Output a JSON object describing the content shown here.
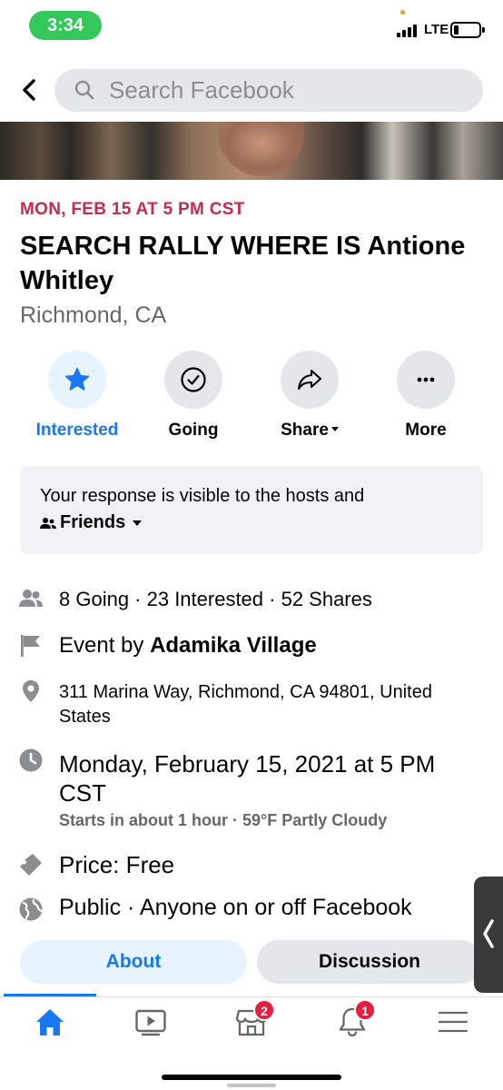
{
  "status_bar": {
    "time": "3:34",
    "network": "LTE"
  },
  "search": {
    "placeholder": "Search Facebook"
  },
  "event": {
    "date_line": "MON, FEB 15 AT 5 PM CST",
    "title": "SEARCH RALLY WHERE IS Antione Whitley",
    "location": "Richmond, CA"
  },
  "actions": [
    {
      "label": "Interested",
      "icon": "star-icon",
      "active": true
    },
    {
      "label": "Going",
      "icon": "check-circle-icon",
      "active": false
    },
    {
      "label": "Share",
      "icon": "share-arrow-icon",
      "active": false
    },
    {
      "label": "More",
      "icon": "more-dots-icon",
      "active": false
    }
  ],
  "response": {
    "text": "Your response is visible to the hosts and",
    "audience": "Friends"
  },
  "details": {
    "attendance": "8 Going · 23 Interested · 52 Shares",
    "host_prefix": "Event by ",
    "host_name": "Adamika Village",
    "address": "311 Marina Way, Richmond, CA 94801, United States",
    "datetime": "Monday, February 15, 2021 at 5 PM CST",
    "datetime_sub": "Starts in about 1 hour · 59°F Partly Cloudy",
    "price": "Price: Free",
    "privacy": "Public · Anyone on or off Facebook"
  },
  "tabs": [
    {
      "label": "About",
      "active": true
    },
    {
      "label": "Discussion",
      "active": false
    }
  ],
  "bottom_nav": [
    {
      "icon": "home-icon",
      "active": true,
      "badge": ""
    },
    {
      "icon": "watch-video-icon",
      "active": false,
      "badge": ""
    },
    {
      "icon": "marketplace-icon",
      "active": false,
      "badge": "2"
    },
    {
      "icon": "notifications-bell-icon",
      "active": false,
      "badge": "1"
    },
    {
      "icon": "menu-icon",
      "active": false,
      "badge": ""
    }
  ],
  "colors": {
    "accent": "#1877f2",
    "date_red": "#c72b4a",
    "badge_red": "#e41e3f",
    "status_green": "#34c759"
  }
}
